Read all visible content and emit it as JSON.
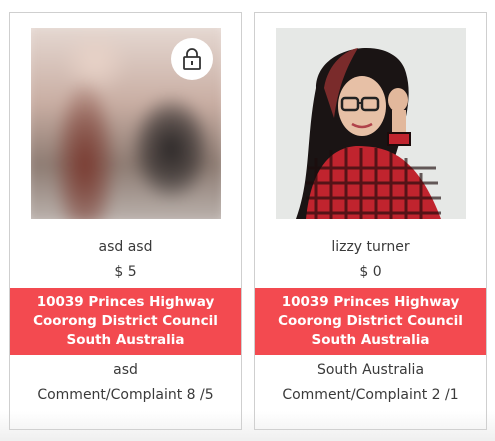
{
  "cards": [
    {
      "name": "asd asd",
      "price": "$ 5",
      "address": [
        "10039 Princes Highway",
        "Coorong District Council",
        "South Australia"
      ],
      "extra": "asd",
      "complaints": "Comment/Complaint 8 /5",
      "locked": true
    },
    {
      "name": "lizzy turner",
      "price": "$ 0",
      "address": [
        "10039 Princes Highway",
        "Coorong District Council",
        "South Australia"
      ],
      "extra": "South Australia",
      "complaints": "Comment/Complaint 2 /1",
      "locked": false
    }
  ],
  "colors": {
    "address_bg": "#f34a50",
    "text": "#3a3a3a",
    "border": "#cfcfcf"
  },
  "icons": {
    "lock": "lock-icon"
  }
}
